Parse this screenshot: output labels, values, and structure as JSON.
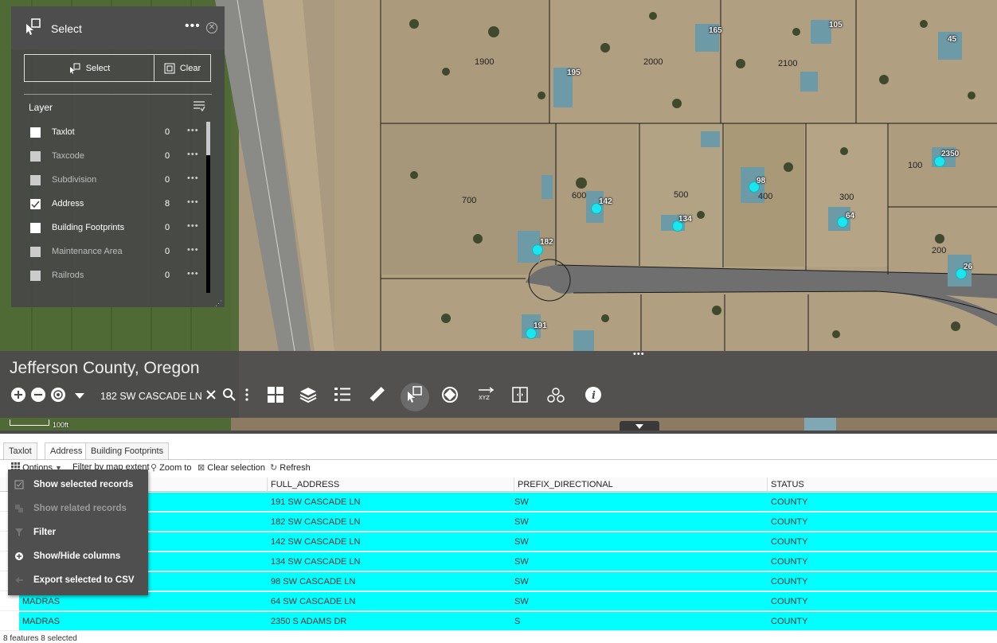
{
  "map": {
    "lot_labels": [
      "1900",
      "2000",
      "2100",
      "700",
      "500",
      "300",
      "100",
      "200",
      "400",
      "600"
    ],
    "address_labels": [
      "165",
      "105",
      "45",
      "195",
      "142",
      "134",
      "98",
      "64",
      "2350",
      "182",
      "26",
      "191"
    ],
    "scale_label": "100ft"
  },
  "select_widget": {
    "title": "Select",
    "select_button": "Select",
    "clear_button": "Clear",
    "layer_header": "Layer",
    "layers": [
      {
        "name": "Taxlot",
        "count": "0",
        "checked": false,
        "dim": false
      },
      {
        "name": "Taxcode",
        "count": "0",
        "checked": false,
        "dim": true
      },
      {
        "name": "Subdivision",
        "count": "0",
        "checked": false,
        "dim": true
      },
      {
        "name": "Address",
        "count": "8",
        "checked": true,
        "dim": false
      },
      {
        "name": "Building Footprints",
        "count": "0",
        "checked": false,
        "dim": false
      },
      {
        "name": "Maintenance Area",
        "count": "0",
        "checked": false,
        "dim": true
      },
      {
        "name": "Railrods",
        "count": "0",
        "checked": false,
        "dim": true
      }
    ]
  },
  "header": {
    "title": "Jefferson County, Oregon",
    "search_value": "182 SW CASCADE LN"
  },
  "attribute_table": {
    "tabs": [
      "Taxlot",
      "Address",
      "Building Footprints"
    ],
    "active_tab": "Address",
    "toolbar": {
      "options": "Options",
      "filter_by_extent": "Filter by map extent",
      "zoom_to": "Zoom to",
      "clear_selection": "Clear selection",
      "refresh": "Refresh"
    },
    "columns": [
      "FULL_ADDRESS",
      "PREFIX_DIRECTIONAL",
      "STATUS"
    ],
    "rows": [
      {
        "city": "",
        "full_address": "191 SW CASCADE LN",
        "prefix": "SW",
        "status": "COUNTY"
      },
      {
        "city": "",
        "full_address": "182 SW CASCADE LN",
        "prefix": "SW",
        "status": "COUNTY"
      },
      {
        "city": "",
        "full_address": "142 SW CASCADE LN",
        "prefix": "SW",
        "status": "COUNTY"
      },
      {
        "city": "",
        "full_address": "134 SW CASCADE LN",
        "prefix": "SW",
        "status": "COUNTY"
      },
      {
        "city": "",
        "full_address": "98 SW CASCADE LN",
        "prefix": "SW",
        "status": "COUNTY"
      },
      {
        "city": "MADRAS",
        "full_address": "64 SW CASCADE LN",
        "prefix": "SW",
        "status": "COUNTY"
      },
      {
        "city": "MADRAS",
        "full_address": "2350 S ADAMS DR",
        "prefix": "S",
        "status": "COUNTY"
      }
    ],
    "status": "8 features  8 selected"
  },
  "options_menu": {
    "items": [
      {
        "label": "Show selected records",
        "disabled": false,
        "icon": "selected-records-icon"
      },
      {
        "label": "Show related records",
        "disabled": true,
        "icon": "related-records-icon"
      },
      {
        "label": "Filter",
        "disabled": false,
        "icon": "filter-icon"
      },
      {
        "label": "Show/Hide columns",
        "disabled": false,
        "icon": "columns-icon"
      },
      {
        "label": "Export selected to CSV",
        "disabled": false,
        "icon": "export-icon"
      }
    ]
  },
  "colors": {
    "selection": "#00ffff",
    "panel": "#484848",
    "address_point": "#19e6ee"
  }
}
